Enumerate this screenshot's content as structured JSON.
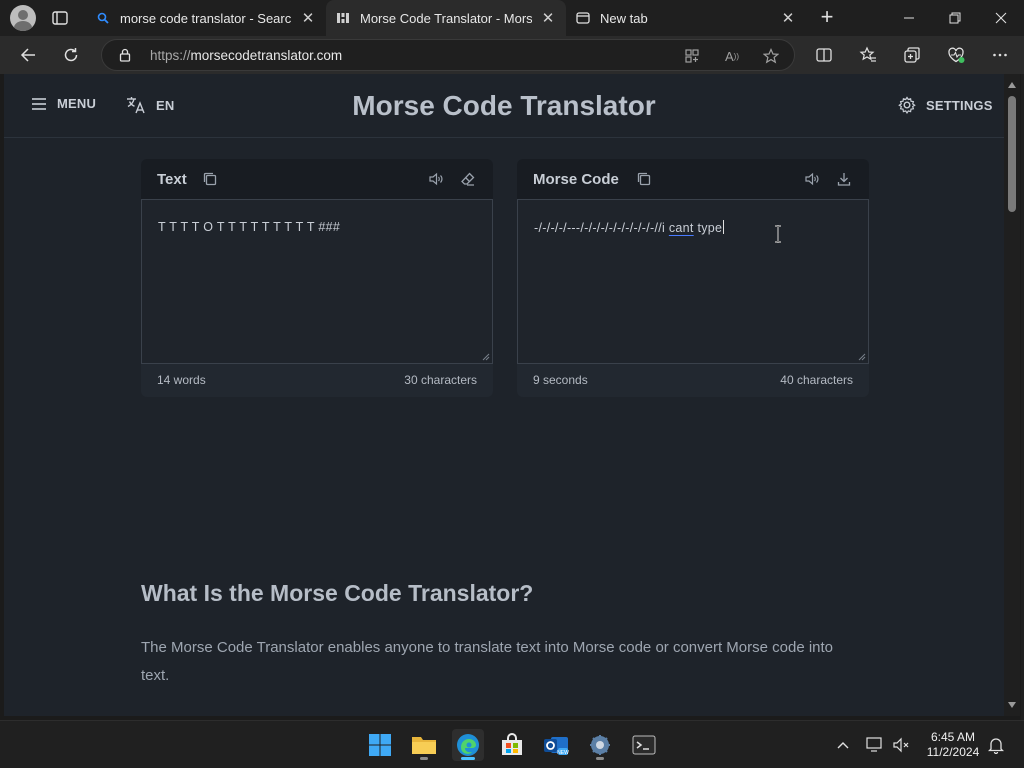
{
  "browser": {
    "tabs": [
      {
        "title": "morse code translator - Search",
        "active": false,
        "icon": "search-icon"
      },
      {
        "title": "Morse Code Translator - Morse Decoder",
        "active": true,
        "icon": "morse-site-icon"
      },
      {
        "title": "New tab",
        "active": false,
        "icon": "newtab-icon"
      }
    ],
    "url_protocol": "https://",
    "url_host": "morsecodetranslator.com"
  },
  "site": {
    "menu_label": "MENU",
    "language_label": "EN",
    "title": "Morse Code Translator",
    "settings_label": "SETTINGS"
  },
  "text_panel": {
    "title": "Text",
    "content": "T T T T O T T T T T T T T T  ###",
    "footer_left": "14 words",
    "footer_right": "30 characters"
  },
  "morse_panel": {
    "title": "Morse Code",
    "content_prefix": "-/-/-/-/---/-/-/-/-/-/-/-/-/-//i ",
    "content_misspelled": "cant",
    "content_suffix": " type",
    "footer_left": "9 seconds",
    "footer_right": "40 characters"
  },
  "article": {
    "heading": "What Is the Morse Code Translator?",
    "paragraph": "The Morse Code Translator enables anyone to translate text into Morse code or convert Morse code into text."
  },
  "taskbar": {
    "time": "6:45 AM",
    "date": "11/2/2024"
  },
  "colors": {
    "page_bg": "#1e232a",
    "panel_head": "#181c22",
    "accent_edge": "#4cc2ff"
  }
}
